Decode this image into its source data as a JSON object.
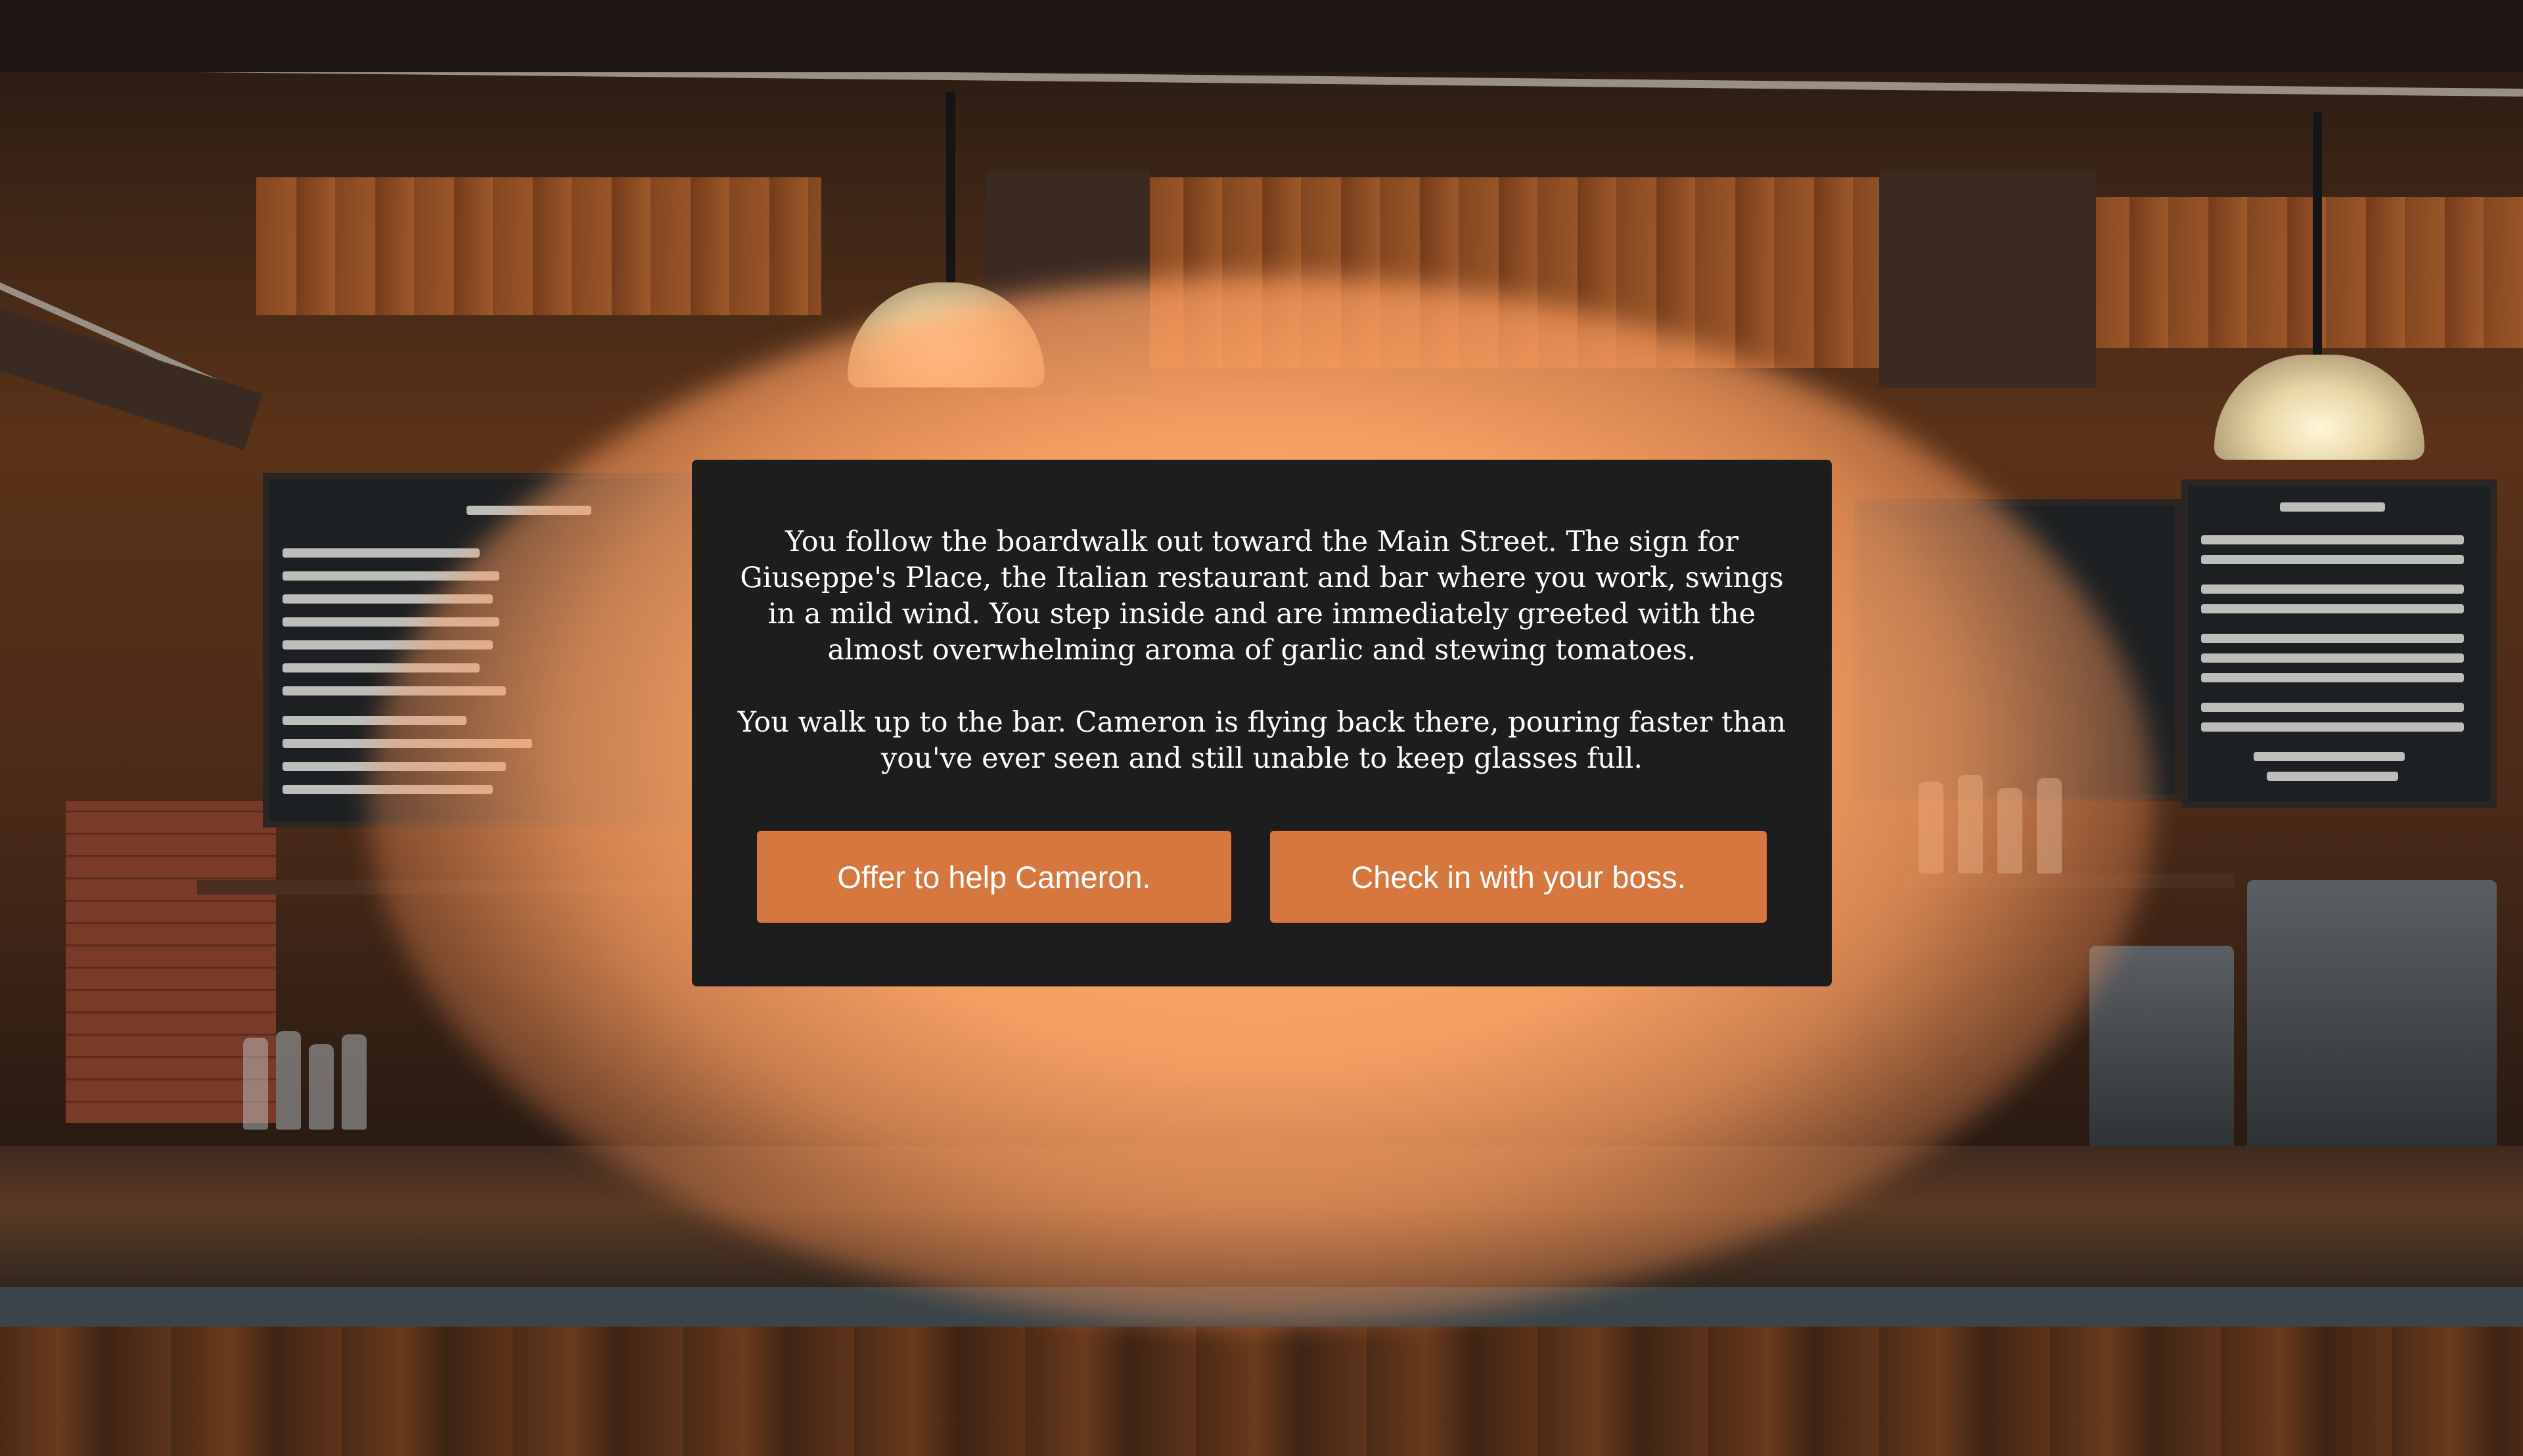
{
  "story": {
    "paragraphs": [
      "You follow the boardwalk out toward the Main Street. The sign for Giuseppe's Place, the Italian restaurant and bar where you work, swings in a mild wind. You step inside and are immediately greeted with the almost overwhelming aroma of garlic and stewing tomatoes.",
      "You walk up to the bar. Cameron is flying back there, pouring faster than you've ever seen and still unable to keep glasses full."
    ]
  },
  "choices": [
    {
      "label": "Offer to help Cameron."
    },
    {
      "label": "Check in with your boss."
    }
  ],
  "theme": {
    "button_color": "#d6773f",
    "dialog_bg": "#1d1d1d",
    "glow_color": "#ffa86c"
  }
}
